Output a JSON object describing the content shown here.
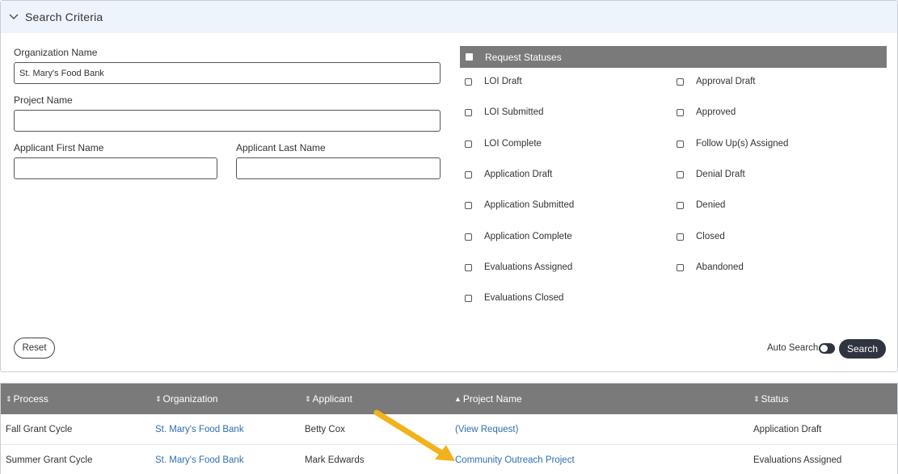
{
  "search_criteria": {
    "title": "Search Criteria",
    "org_name_label": "Organization Name",
    "org_name_value": "St. Mary's Food Bank",
    "project_name_label": "Project Name",
    "project_name_value": "",
    "first_name_label": "Applicant First Name",
    "first_name_value": "",
    "last_name_label": "Applicant Last Name",
    "last_name_value": "",
    "reset_label": "Reset",
    "auto_search_label": "Auto Search",
    "auto_search_on": false,
    "search_label": "Search"
  },
  "request_statuses": {
    "header": "Request Statuses",
    "left": [
      "LOI Draft",
      "LOI Submitted",
      "LOI Complete",
      "Application Draft",
      "Application Submitted",
      "Application Complete",
      "Evaluations Assigned",
      "Evaluations Closed"
    ],
    "right": [
      "Approval Draft",
      "Approved",
      "Follow Up(s) Assigned",
      "Denial Draft",
      "Denied",
      "Closed",
      "Abandoned"
    ]
  },
  "results": {
    "columns": [
      {
        "label": "Process",
        "sort": "both"
      },
      {
        "label": "Organization",
        "sort": "both"
      },
      {
        "label": "Applicant",
        "sort": "both"
      },
      {
        "label": "Project Name",
        "sort": "asc"
      },
      {
        "label": "Status",
        "sort": "both"
      }
    ],
    "rows": [
      {
        "process": "Fall Grant Cycle",
        "organization": "St. Mary's Food Bank",
        "applicant": "Betty Cox",
        "project": "(View Request)",
        "status": "Application Draft"
      },
      {
        "process": "Summer Grant Cycle",
        "organization": "St. Mary's Food Bank",
        "applicant": "Mark Edwards",
        "project": "Community Outreach Project",
        "status": "Evaluations Assigned"
      }
    ]
  },
  "colors": {
    "header_bg": "#eef4fc",
    "table_header": "#7a7a7a",
    "link": "#2d6fb5",
    "dark_button": "#2f3440",
    "annotation_arrow": "#f2b21b"
  }
}
